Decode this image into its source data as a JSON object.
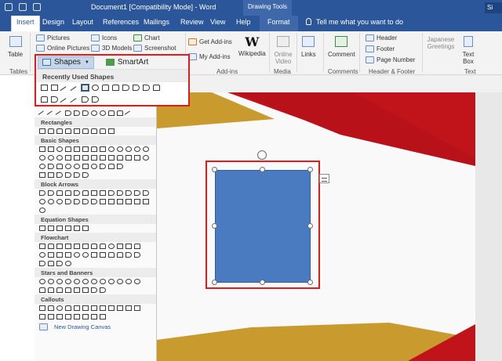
{
  "titlebar": {
    "doc_title": "Document1 [Compatibility Mode] - Word",
    "contextual_header": "Drawing Tools",
    "signin": "Si"
  },
  "tabs": [
    "Insert",
    "Design",
    "Layout",
    "References",
    "Mailings",
    "Review",
    "View",
    "Help",
    "Format"
  ],
  "tell_me": "Tell me what you want to do",
  "ribbon": {
    "tables": {
      "table_label": "Table",
      "group_label": "Tables"
    },
    "illustrations": {
      "pictures": "Pictures",
      "online_pictures": "Online Pictures",
      "icons": "Icons",
      "models_3d": "3D Models",
      "chart": "Chart",
      "screenshot": "Screenshot"
    },
    "addins": {
      "get_addins": "Get Add-ins",
      "my_addins": "My Add-ins",
      "wikipedia": "Wikipedia",
      "wikipedia_glyph": "W",
      "group_label": "Add-ins"
    },
    "media": {
      "online_video": "Online Video",
      "group_label": "Media"
    },
    "links": {
      "label": "Links"
    },
    "comments": {
      "comment": "Comment",
      "group_label": "Comments"
    },
    "header_footer": {
      "header": "Header",
      "footer": "Footer",
      "page_number": "Page Number",
      "group_label": "Header & Footer"
    },
    "text": {
      "japanese_greetings": "Japanese Greetings",
      "text_box": "Text Box",
      "group_label": "Text"
    }
  },
  "shapes_gallery": {
    "shapes_button": "Shapes",
    "smartart_button": "SmartArt",
    "recently_used": "Recently Used Shapes",
    "sections": [
      "Rectangles",
      "Basic Shapes",
      "Block Arrows",
      "Equation Shapes",
      "Flowchart",
      "Stars and Banners",
      "Callouts"
    ],
    "new_canvas": "New Drawing Canvas"
  },
  "colors": {
    "title_blue": "#2b579a",
    "highlight_red": "#e41b1b",
    "shape_fill": "#4a7bc0",
    "deco_red": "#c0141a",
    "deco_gold": "#c99a2e"
  }
}
